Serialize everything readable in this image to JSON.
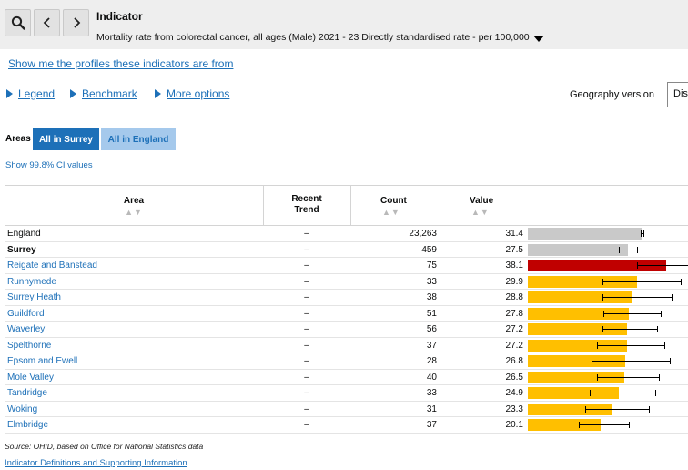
{
  "indicator": {
    "title": "Indicator",
    "description": "Mortality rate from colorectal cancer, all ages (Male)  2021 - 23  Directly standardised rate - per 100,000"
  },
  "links": {
    "profiles": "Show me the profiles these indicators are from",
    "legend": "Legend",
    "benchmark": "Benchmark",
    "more_options": "More options",
    "show_ci": "Show 99.8% CI values",
    "definitions": "Indicator Definitions and Supporting Information"
  },
  "geography": {
    "label": "Geography version",
    "selected": "Dis"
  },
  "areas_toggle": {
    "label": "Areas",
    "active": "All in Surrey",
    "inactive": "All in England"
  },
  "table": {
    "headers": {
      "area": "Area",
      "trend": "Recent Trend",
      "count": "Count",
      "value": "Value"
    },
    "sort_glyph": "▲▼",
    "scale_max": 45,
    "rows": [
      {
        "area": "England",
        "trend": "–",
        "count": "23,263",
        "value": "31.4",
        "v": 31.4,
        "lo": 31.0,
        "hi": 31.8,
        "color": "#c9c9c9",
        "type": "plain"
      },
      {
        "area": "Surrey",
        "trend": "–",
        "count": "459",
        "value": "27.5",
        "v": 27.5,
        "lo": 25.0,
        "hi": 30.1,
        "color": "#c9c9c9",
        "type": "bold"
      },
      {
        "area": "Reigate and Banstead",
        "trend": "–",
        "count": "75",
        "value": "38.1",
        "v": 38.1,
        "lo": 30.0,
        "hi": 47.7,
        "color": "#c00000",
        "type": "link"
      },
      {
        "area": "Runnymede",
        "trend": "–",
        "count": "33",
        "value": "29.9",
        "v": 29.9,
        "lo": 20.5,
        "hi": 42.0,
        "color": "#ffbf00",
        "type": "link"
      },
      {
        "area": "Surrey Heath",
        "trend": "–",
        "count": "38",
        "value": "28.8",
        "v": 28.8,
        "lo": 20.4,
        "hi": 39.6,
        "color": "#ffbf00",
        "type": "link"
      },
      {
        "area": "Guildford",
        "trend": "–",
        "count": "51",
        "value": "27.8",
        "v": 27.8,
        "lo": 20.7,
        "hi": 36.6,
        "color": "#ffbf00",
        "type": "link"
      },
      {
        "area": "Waverley",
        "trend": "–",
        "count": "56",
        "value": "27.2",
        "v": 27.2,
        "lo": 20.6,
        "hi": 35.4,
        "color": "#ffbf00",
        "type": "link"
      },
      {
        "area": "Spelthorne",
        "trend": "–",
        "count": "37",
        "value": "27.2",
        "v": 27.2,
        "lo": 19.1,
        "hi": 37.6,
        "color": "#ffbf00",
        "type": "link"
      },
      {
        "area": "Epsom and Ewell",
        "trend": "–",
        "count": "28",
        "value": "26.8",
        "v": 26.8,
        "lo": 17.6,
        "hi": 39.1,
        "color": "#ffbf00",
        "type": "link"
      },
      {
        "area": "Mole Valley",
        "trend": "–",
        "count": "40",
        "value": "26.5",
        "v": 26.5,
        "lo": 18.9,
        "hi": 36.1,
        "color": "#ffbf00",
        "type": "link"
      },
      {
        "area": "Tandridge",
        "trend": "–",
        "count": "33",
        "value": "24.9",
        "v": 24.9,
        "lo": 17.1,
        "hi": 35.1,
        "color": "#ffbf00",
        "type": "link"
      },
      {
        "area": "Woking",
        "trend": "–",
        "count": "31",
        "value": "23.3",
        "v": 23.3,
        "lo": 15.8,
        "hi": 33.2,
        "color": "#ffbf00",
        "type": "link"
      },
      {
        "area": "Elmbridge",
        "trend": "–",
        "count": "37",
        "value": "20.1",
        "v": 20.1,
        "lo": 14.1,
        "hi": 27.8,
        "color": "#ffbf00",
        "type": "link"
      }
    ]
  },
  "source": "Source: OHID, based on Office for National Statistics data"
}
